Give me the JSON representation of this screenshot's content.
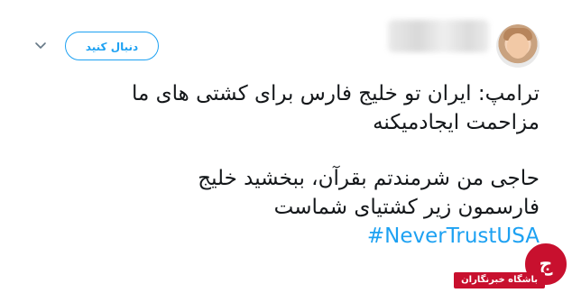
{
  "tweet": {
    "follow_label": "دنبال کنید",
    "lines_1": [
      "ترامپ: ایران تو خلیج فارس برای کشتی های ما",
      "مزاحمت ایجادمیکنه"
    ],
    "lines_2": [
      "حاجی من شرمندتم بقرآن، ببخشید خلیج",
      "فارسمون زیر کشتیای شماست"
    ],
    "hashtag": "#NeverTrustUSA"
  },
  "watermark": {
    "logo_letter": "ج",
    "label": "باشگاه خبرنگاران"
  },
  "colors": {
    "accent": "#1da1f2",
    "text": "#14171a",
    "watermark_red": "#c8102e"
  }
}
